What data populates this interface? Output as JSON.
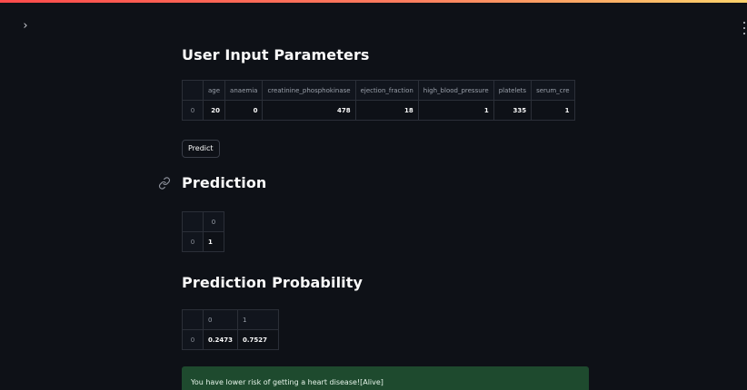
{
  "app": {
    "accent_gradient": [
      "#ff4b4b",
      "#ff7e5f",
      "#ffd36b"
    ],
    "background": "#0e1117",
    "sidebar_toggle_icon": "chevron-right-icon",
    "sidebar_toggle_glyph": "›"
  },
  "sections": {
    "params_title": "User Input Parameters",
    "prediction_title": "Prediction",
    "probability_title": "Prediction Probability"
  },
  "params_table": {
    "columns": [
      "age",
      "anaemia",
      "creatinine_phosphokinase",
      "ejection_fraction",
      "high_blood_pressure",
      "platelets",
      "serum_cre"
    ],
    "index": "0",
    "values": [
      "20",
      "0",
      "478",
      "18",
      "1",
      "335",
      "1"
    ]
  },
  "predict_button": {
    "label": "Predict"
  },
  "prediction_table": {
    "columns": [
      "0"
    ],
    "index": "0",
    "values": [
      "1"
    ]
  },
  "probability_table": {
    "columns": [
      "0",
      "1"
    ],
    "index": "0",
    "values": [
      "0.2473",
      "0.7527"
    ]
  },
  "result_alert": {
    "text": "You have lower risk of getting a heart disease![Alive]",
    "color": "#1e4a2e"
  }
}
